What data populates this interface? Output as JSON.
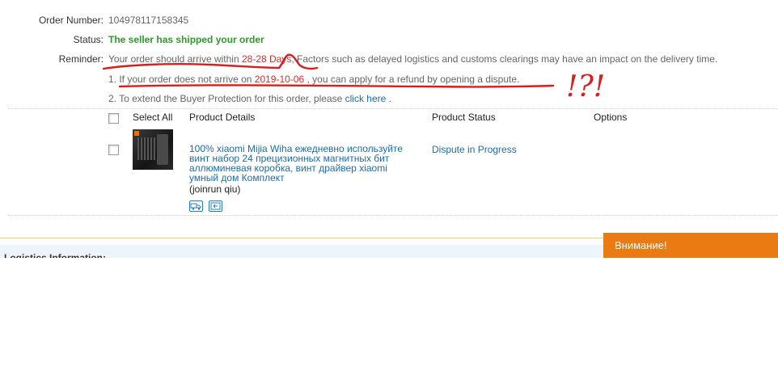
{
  "order": {
    "number_label": "Order Number:",
    "number": "104978117158345",
    "status_label": "Status:",
    "status": "The seller has shipped your order",
    "reminder_label": "Reminder:",
    "reminder_prefix": "Your order should arrive within ",
    "reminder_days": "28-28 Days",
    "reminder_suffix": ", Factors such as delayed logistics and customs clearings may have an impact on the delivery time.",
    "note1_prefix": "1. If your order does not arrive on ",
    "note1_date": "2019-10-06",
    "note1_suffix": " , you can apply for a refund by opening a dispute.",
    "note2_prefix": "2. To extend the Buyer Protection for this order, please ",
    "note2_link": "click here",
    "note2_suffix": " ."
  },
  "table": {
    "select_all": "Select All",
    "col_details": "Product Details",
    "col_status": "Product Status",
    "col_options": "Options"
  },
  "product": {
    "title": "100% xiaomi Mijia Wiha ежедневно используйте винт набор 24 прецизионных магнитных бит аллюминевая коробка, винт драйвер xiaomi умный дом Комплект",
    "seller": "(joinrun qiu)",
    "status": "Dispute in Progress"
  },
  "logistics": {
    "title": "Logistics Information:"
  },
  "popup": {
    "attention": "Внимание!"
  },
  "annotation": {
    "marks": "!?!"
  },
  "colors": {
    "status_green": "#2a9c26",
    "highlight_red": "#d42f2f",
    "link_blue": "#1d6bb5",
    "popup_orange": "#ea7b12",
    "ink_red": "#d81e1e"
  },
  "icons": [
    "checkbox-icon",
    "truck-icon",
    "return-icon"
  ]
}
